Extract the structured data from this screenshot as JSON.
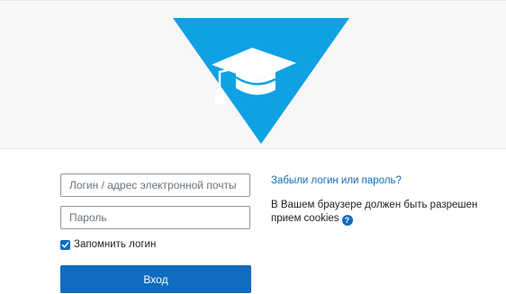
{
  "login_form": {
    "username_placeholder": "Логин / адрес электронной почты",
    "password_placeholder": "Пароль",
    "remember_label": "Запомнить логин",
    "remember_checked": true,
    "submit_label": "Вход"
  },
  "aside": {
    "forgot_link": "Забыли логин или пароль?",
    "cookies_notice": "В Вашем браузере должен быть разрешен прием cookies",
    "help_icon": "question-circle-icon",
    "help_glyph": "?"
  },
  "logo": {
    "icon": "graduation-cap-icon"
  },
  "colors": {
    "accent": "#0f6cbf",
    "logo_blue": "#0fa1e4",
    "header_bg": "#f7f7f7"
  }
}
